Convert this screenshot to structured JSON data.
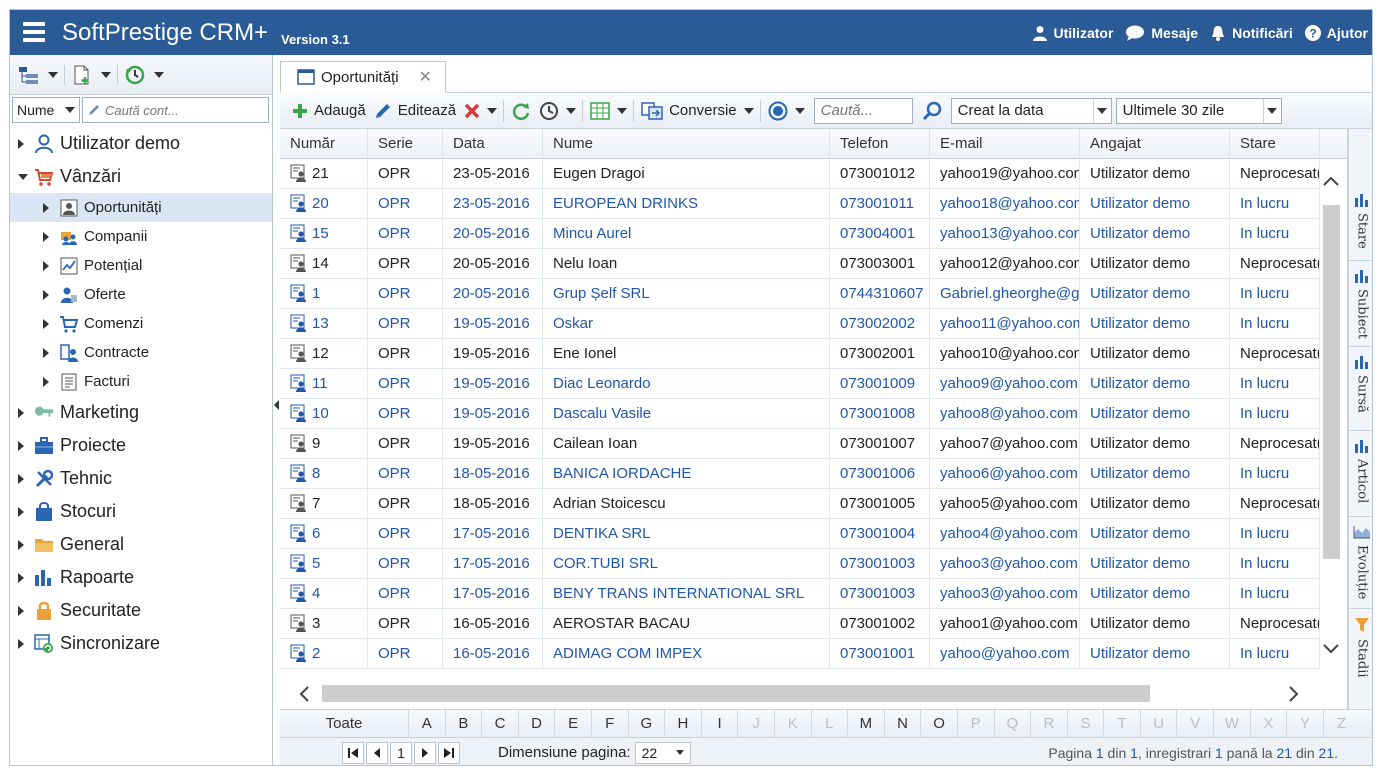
{
  "header": {
    "title": "SoftPrestige CRM+",
    "version": "Version 3.1",
    "links": {
      "user": "Utilizator",
      "messages": "Mesaje",
      "notifications": "Notificări",
      "help": "Ajutor"
    }
  },
  "sidebar": {
    "search_field": "Nume",
    "search_placeholder": "Caută cont...",
    "tree": {
      "user": "Utilizator demo",
      "sales": "Vânzări",
      "sales_children": {
        "opportunities": "Oportunități",
        "companies": "Companii",
        "potential": "Potențial",
        "offers": "Oferte",
        "orders": "Comenzi",
        "contracts": "Contracte",
        "invoices": "Facturi"
      },
      "marketing": "Marketing",
      "projects": "Proiecte",
      "technical": "Tehnic",
      "stocks": "Stocuri",
      "general": "General",
      "reports": "Rapoarte",
      "security": "Securitate",
      "sync": "Sincronizare"
    }
  },
  "tab": {
    "label": "Oportunități",
    "close": "✕"
  },
  "toolbar": {
    "add": "Adaugă",
    "edit": "Editează",
    "convert": "Conversie",
    "search_placeholder": "Caută...",
    "field_filter": "Creat la data",
    "period_filter": "Ultimele 30 zile"
  },
  "grid": {
    "columns": {
      "number": "Număr",
      "series": "Serie",
      "date": "Data",
      "name": "Nume",
      "phone": "Telefon",
      "email": "E-mail",
      "employee": "Angajat",
      "status": "Stare"
    },
    "rows": [
      {
        "number": "21",
        "series": "OPR",
        "date": "23-05-2016",
        "name": "Eugen Dragoi",
        "phone": "073001012",
        "email": "yahoo19@yahoo.com",
        "employee": "Utilizator demo",
        "status": "Neprocesat(",
        "blue": false
      },
      {
        "number": "20",
        "series": "OPR",
        "date": "23-05-2016",
        "name": "EUROPEAN DRINKS",
        "phone": "073001011",
        "email": "yahoo18@yahoo.com",
        "employee": "Utilizator demo",
        "status": "In lucru",
        "blue": true
      },
      {
        "number": "15",
        "series": "OPR",
        "date": "20-05-2016",
        "name": "Mincu Aurel",
        "phone": "073004001",
        "email": "yahoo13@yahoo.com",
        "employee": "Utilizator demo",
        "status": "In lucru",
        "blue": true
      },
      {
        "number": "14",
        "series": "OPR",
        "date": "20-05-2016",
        "name": "Nelu Ioan",
        "phone": "073003001",
        "email": "yahoo12@yahoo.com",
        "employee": "Utilizator demo",
        "status": "Neprocesat(",
        "blue": false
      },
      {
        "number": "1",
        "series": "OPR",
        "date": "20-05-2016",
        "name": "Grup Șelf SRL",
        "phone": "0744310607",
        "email": "Gabriel.gheorghe@g",
        "employee": "Utilizator demo",
        "status": "In lucru",
        "blue": true
      },
      {
        "number": "13",
        "series": "OPR",
        "date": "19-05-2016",
        "name": "Oskar",
        "phone": "073002002",
        "email": "yahoo11@yahoo.com",
        "employee": "Utilizator demo",
        "status": "In lucru",
        "blue": true
      },
      {
        "number": "12",
        "series": "OPR",
        "date": "19-05-2016",
        "name": "Ene Ionel",
        "phone": "073002001",
        "email": "yahoo10@yahoo.com",
        "employee": "Utilizator demo",
        "status": "Neprocesat(",
        "blue": false
      },
      {
        "number": "11",
        "series": "OPR",
        "date": "19-05-2016",
        "name": "Diac Leonardo",
        "phone": "073001009",
        "email": "yahoo9@yahoo.com",
        "employee": "Utilizator demo",
        "status": "In lucru",
        "blue": true
      },
      {
        "number": "10",
        "series": "OPR",
        "date": "19-05-2016",
        "name": "Dascalu Vasile",
        "phone": "073001008",
        "email": "yahoo8@yahoo.com",
        "employee": "Utilizator demo",
        "status": "In lucru",
        "blue": true
      },
      {
        "number": "9",
        "series": "OPR",
        "date": "19-05-2016",
        "name": "Cailean Ioan",
        "phone": "073001007",
        "email": "yahoo7@yahoo.com",
        "employee": "Utilizator demo",
        "status": "Neprocesat(",
        "blue": false
      },
      {
        "number": "8",
        "series": "OPR",
        "date": "18-05-2016",
        "name": "BANICA IORDACHE",
        "phone": "073001006",
        "email": "yahoo6@yahoo.com",
        "employee": "Utilizator demo",
        "status": "In lucru",
        "blue": true
      },
      {
        "number": "7",
        "series": "OPR",
        "date": "18-05-2016",
        "name": "Adrian Stoicescu",
        "phone": "073001005",
        "email": "yahoo5@yahoo.com",
        "employee": "Utilizator demo",
        "status": "Neprocesat(",
        "blue": false
      },
      {
        "number": "6",
        "series": "OPR",
        "date": "17-05-2016",
        "name": "DENTIKA SRL",
        "phone": "073001004",
        "email": "yahoo4@yahoo.com",
        "employee": "Utilizator demo",
        "status": "In lucru",
        "blue": true
      },
      {
        "number": "5",
        "series": "OPR",
        "date": "17-05-2016",
        "name": "COR.TUBI SRL",
        "phone": "073001003",
        "email": "yahoo3@yahoo.com",
        "employee": "Utilizator demo",
        "status": "In lucru",
        "blue": true
      },
      {
        "number": "4",
        "series": "OPR",
        "date": "17-05-2016",
        "name": "BENY TRANS INTERNATIONAL SRL",
        "phone": "073001003",
        "email": "yahoo3@yahoo.com",
        "employee": "Utilizator demo",
        "status": "In lucru",
        "blue": true
      },
      {
        "number": "3",
        "series": "OPR",
        "date": "16-05-2016",
        "name": "AEROSTAR BACAU",
        "phone": "073001002",
        "email": "yahoo1@yahoo.com",
        "employee": "Utilizator demo",
        "status": "Neprocesat(",
        "blue": false
      },
      {
        "number": "2",
        "series": "OPR",
        "date": "16-05-2016",
        "name": "ADIMAG COM IMPEX",
        "phone": "073001001",
        "email": "yahoo@yahoo.com",
        "employee": "Utilizator demo",
        "status": "In lucru",
        "blue": true
      }
    ]
  },
  "side_tabs": [
    "Stare",
    "Subiect",
    "Sursă",
    "Articol",
    "Evoluție",
    "Stadii"
  ],
  "alphabet": {
    "all": "Toate",
    "letters": [
      "A",
      "B",
      "C",
      "D",
      "E",
      "F",
      "G",
      "H",
      "I",
      "J",
      "K",
      "L",
      "M",
      "N",
      "O",
      "P",
      "Q",
      "R",
      "S",
      "T",
      "U",
      "V",
      "W",
      "X",
      "Y",
      "Z"
    ],
    "enabled": [
      "A",
      "B",
      "C",
      "D",
      "E",
      "F",
      "G",
      "H",
      "I",
      "M",
      "N",
      "O"
    ]
  },
  "pager": {
    "current_page": "1",
    "page_size_label": "Dimensiune pagina:",
    "page_size": "22",
    "info_prefix": "Pagina ",
    "info_page": "1",
    "info_of": " din ",
    "info_pages": "1",
    "info_records": ", inregistrari ",
    "info_from": "1",
    "info_to_word": " pană la ",
    "info_to": "21",
    "info_total_word": " din ",
    "info_total": "21",
    "info_end": "."
  },
  "colors": {
    "header_bg": "#2b5b96",
    "link_blue": "#2057a8",
    "selected_bg": "#dae6f3"
  }
}
